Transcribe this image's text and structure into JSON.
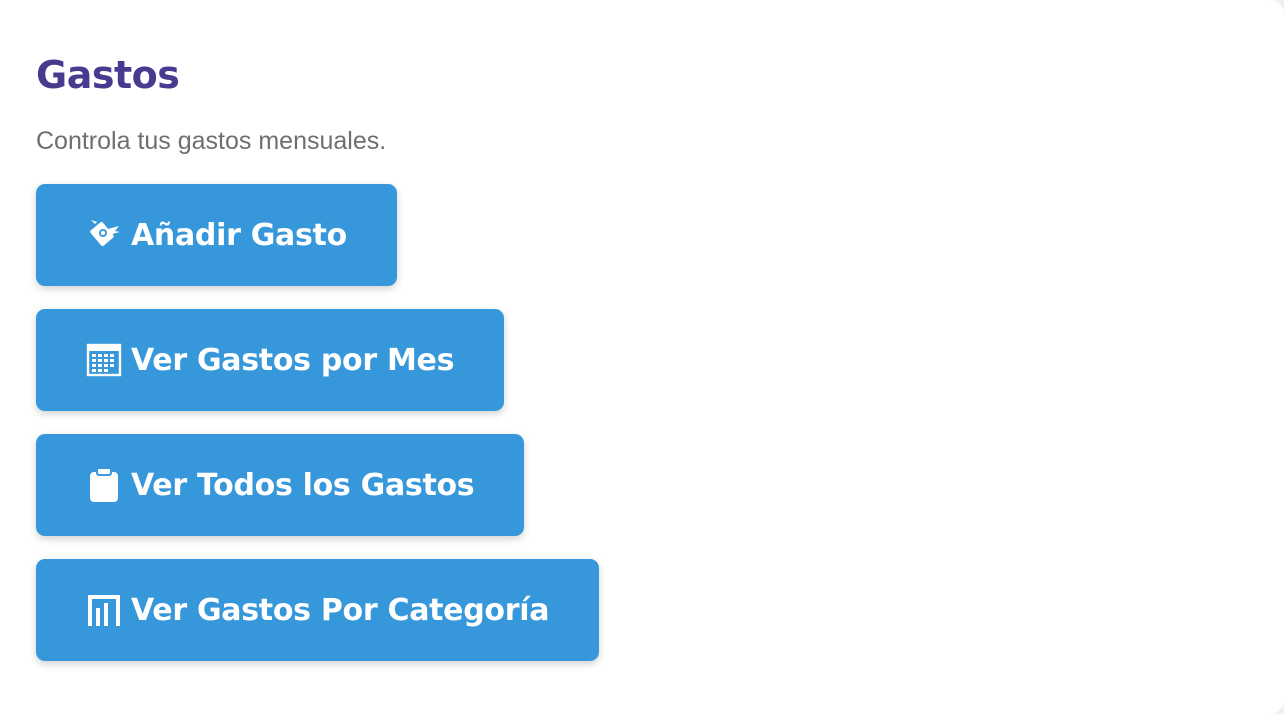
{
  "header": {
    "title": "Gastos",
    "subtitle": "Controla tus gastos mensuales."
  },
  "actions": [
    {
      "label": "Añadir Gasto",
      "icon": "money-wings-icon"
    },
    {
      "label": "Ver Gastos por Mes",
      "icon": "calendar-icon"
    },
    {
      "label": "Ver Todos los Gastos",
      "icon": "clipboard-icon"
    },
    {
      "label": "Ver Gastos Por Categoría",
      "icon": "bar-chart-icon"
    }
  ],
  "colors": {
    "title": "#4a3a8f",
    "subtitle": "#6f6f6f",
    "button_bg": "#3797db",
    "button_text": "#ffffff"
  }
}
